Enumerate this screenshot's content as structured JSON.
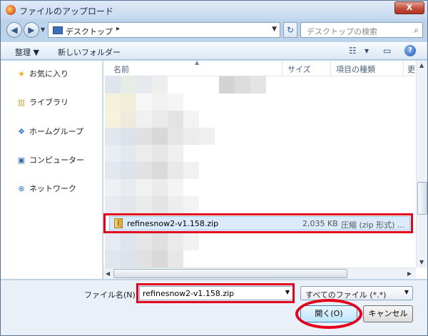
{
  "window": {
    "title": "ファイルのアップロード",
    "close_label": "X"
  },
  "navbar": {
    "back_icon": "back-arrow-icon",
    "forward_icon": "forward-arrow-icon",
    "address": "デスクトップ",
    "search_placeholder": "デスクトップの検索"
  },
  "toolbar": {
    "organize": "整理 ▼",
    "new_folder": "新しいフォルダー"
  },
  "sidebar": {
    "items": [
      {
        "label": "お気に入り",
        "icon": "star-icon"
      },
      {
        "label": "ライブラリ",
        "icon": "library-icon"
      },
      {
        "label": "ホームグループ",
        "icon": "homegroup-icon"
      },
      {
        "label": "コンピューター",
        "icon": "computer-icon"
      },
      {
        "label": "ネットワーク",
        "icon": "network-icon"
      }
    ]
  },
  "list": {
    "columns": {
      "name": "名前",
      "size": "サイズ",
      "type": "項目の種類",
      "extra": "更"
    },
    "selected_file": {
      "name": "refinesnow2-v1.158.zip",
      "size": "2,035 KB",
      "type": "圧縮 (zip 形式) ..."
    }
  },
  "footer": {
    "filename_label": "ファイル名(N):",
    "filename_value": "refinesnow2-v1.158.zip",
    "filter": "すべてのファイル (*.*)",
    "open_label": "開く(O)",
    "cancel_label": "キャンセル"
  },
  "colors": {
    "highlight_red": "#e2021b",
    "selection": "#dcebfb"
  }
}
